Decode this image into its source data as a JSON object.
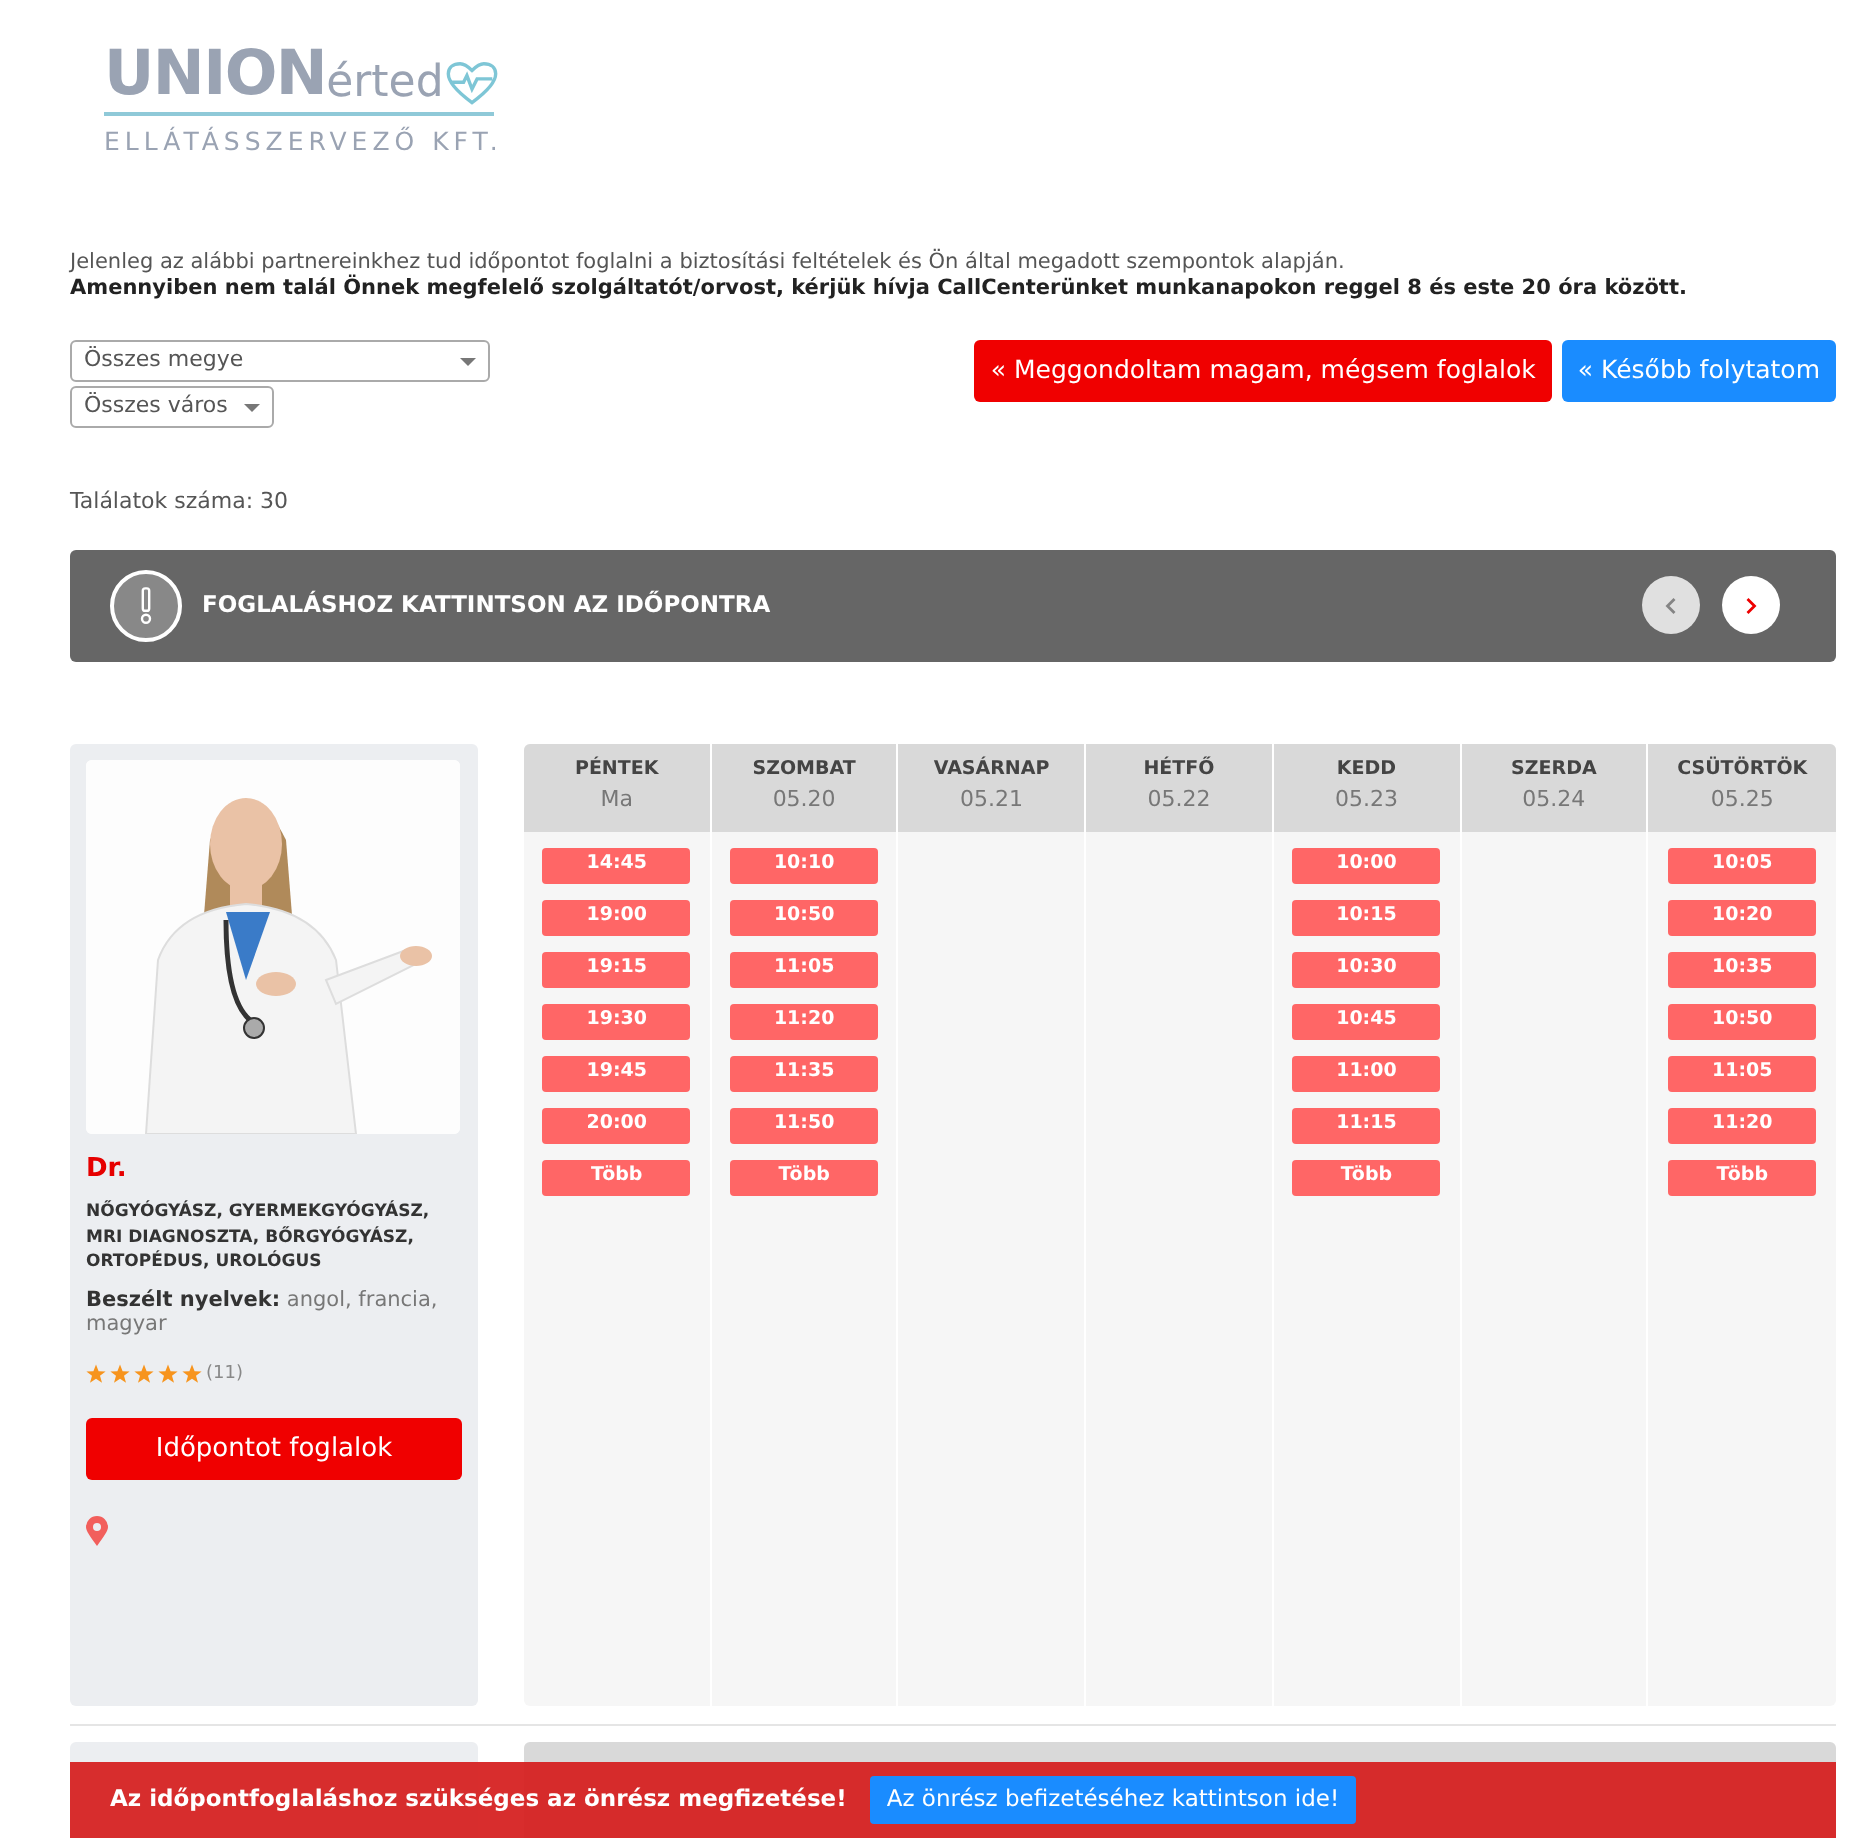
{
  "logo": {
    "brand": "UNION",
    "brand_suffix": "érted",
    "subtitle": "ELLÁTÁSSZERVEZŐ KFT."
  },
  "intro": {
    "line": "Jelenleg az alábbi partnereinkhez tud időpontot foglalni a biztosítási feltételek és Ön által megadott szempontok alapján.",
    "notice": "Amennyiben nem talál Önnek megfelelő szolgáltatót/orvost, kérjük hívja CallCenterünket munkanapokon reggel 8 és este 20 óra között."
  },
  "filters": [
    {
      "value": "Összes megye"
    },
    {
      "value": "Összes város"
    }
  ],
  "buttons": [
    {
      "label": "« Meggondoltam magam, mégsem foglalok",
      "kind": "danger"
    },
    {
      "label": "« Később folytatom",
      "kind": "primary"
    }
  ],
  "result_count": "Találatok száma: 30",
  "banner": {
    "title": "FOGLALÁSHOZ KATTINTSON AZ IDŐPONTRA",
    "nav": [
      {
        "kind": "prev",
        "disabled": true
      },
      {
        "kind": "next",
        "disabled": false
      }
    ]
  },
  "doctor": {
    "kind": "picture",
    "name": "Dr.",
    "specialties": "NŐGYÓGYÁSZ, GYERMEKGYÓGYÁSZ, MRI DIAGNOSZTA, BŐRGYÓGYÁSZ, ORTOPÉDUS, UROLÓGUS",
    "languages_label": "Beszélt nyelvek:",
    "languages": "angol, francia, magyar",
    "stars": 5,
    "rating_count": "(11)",
    "book_button": "Időpontot foglalok"
  },
  "schedule": [
    {
      "day": "PÉNTEK",
      "date": "Ma",
      "slots": [
        "14:45",
        "19:00",
        "19:15",
        "19:30",
        "19:45",
        "20:00"
      ],
      "more": "Több"
    },
    {
      "day": "SZOMBAT",
      "date": "05.20",
      "slots": [
        "10:10",
        "10:50",
        "11:05",
        "11:20",
        "11:35",
        "11:50"
      ],
      "more": "Több"
    },
    {
      "day": "VASÁRNAP",
      "date": "05.21"
    },
    {
      "day": "HÉTFŐ",
      "date": "05.22"
    },
    {
      "day": "KEDD",
      "date": "05.23",
      "slots": [
        "10:00",
        "10:15",
        "10:30",
        "10:45",
        "11:00",
        "11:15"
      ],
      "more": "Több"
    },
    {
      "day": "SZERDA",
      "date": "05.24"
    },
    {
      "day": "CSÜTÖRTÖK",
      "date": "05.25",
      "slots": [
        "10:05",
        "10:20",
        "10:35",
        "10:50",
        "11:05",
        "11:20"
      ],
      "more": "Több"
    }
  ],
  "payment_bar": {
    "message": "Az időpontfoglaláshoz szükséges az önrész megfizetése!",
    "button": "Az önrész befizetéséhez kattintson ide!"
  }
}
